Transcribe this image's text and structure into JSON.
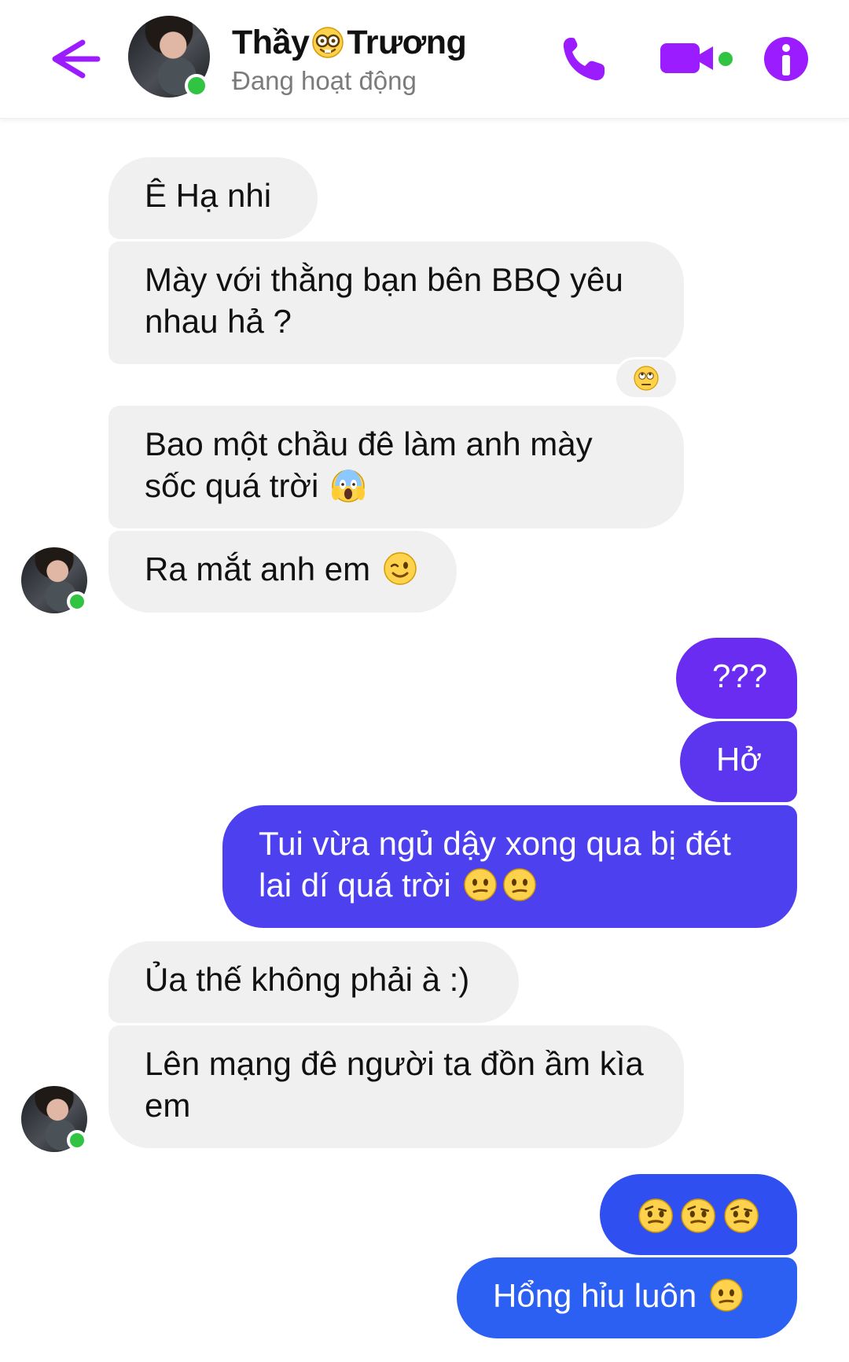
{
  "header": {
    "title_part_1": "Thầy",
    "title_part_2": "Trương",
    "status": "Đang hoạt động",
    "icons": {
      "back": "arrow-left-icon",
      "call": "phone-icon",
      "video": "video-camera-icon",
      "info": "info-icon",
      "title_emoji": "nerd-face-icon"
    },
    "accent_color": "#9b1cff"
  },
  "messages": [
    {
      "id": "m1",
      "direction": "incoming",
      "text": "Ê Hạ nhi"
    },
    {
      "id": "m2",
      "direction": "incoming",
      "text": "Mày với thằng bạn bên BBQ yêu nhau hả ?",
      "reaction": "face-with-rolling-eyes-icon"
    },
    {
      "id": "m3",
      "direction": "incoming",
      "text": "Bao một chầu đê làm anh mày sốc quá trời",
      "emoji": "face-screaming-in-fear-icon"
    },
    {
      "id": "m4",
      "direction": "incoming",
      "text": "Ra mắt anh em",
      "emoji": "winking-face-icon"
    },
    {
      "id": "m5",
      "direction": "outgoing",
      "text": "???"
    },
    {
      "id": "m6",
      "direction": "outgoing",
      "text": "Hở"
    },
    {
      "id": "m7",
      "direction": "outgoing",
      "text": "Tui vừa ngủ dậy xong qua bị đét lai dí quá trời",
      "emoji": [
        "confused-face-icon",
        "confused-face-icon"
      ]
    },
    {
      "id": "m8",
      "direction": "incoming",
      "text": "Ủa thế không phải à :)"
    },
    {
      "id": "m9",
      "direction": "incoming",
      "text": "Lên mạng đê người ta đồn ầm kìa em"
    },
    {
      "id": "m10",
      "direction": "outgoing",
      "text": "",
      "emoji": [
        "face-with-raised-eyebrow-icon",
        "face-with-raised-eyebrow-icon",
        "face-with-raised-eyebrow-icon"
      ]
    },
    {
      "id": "m11",
      "direction": "outgoing",
      "text": "Hổng hỉu luôn",
      "emoji": "confused-face-icon"
    }
  ],
  "colors": {
    "incoming_bubble": "#f0f0f0",
    "outgoing_top": "#6b2cf1",
    "outgoing_bottom": "#2b60f3",
    "online": "#31c342"
  }
}
